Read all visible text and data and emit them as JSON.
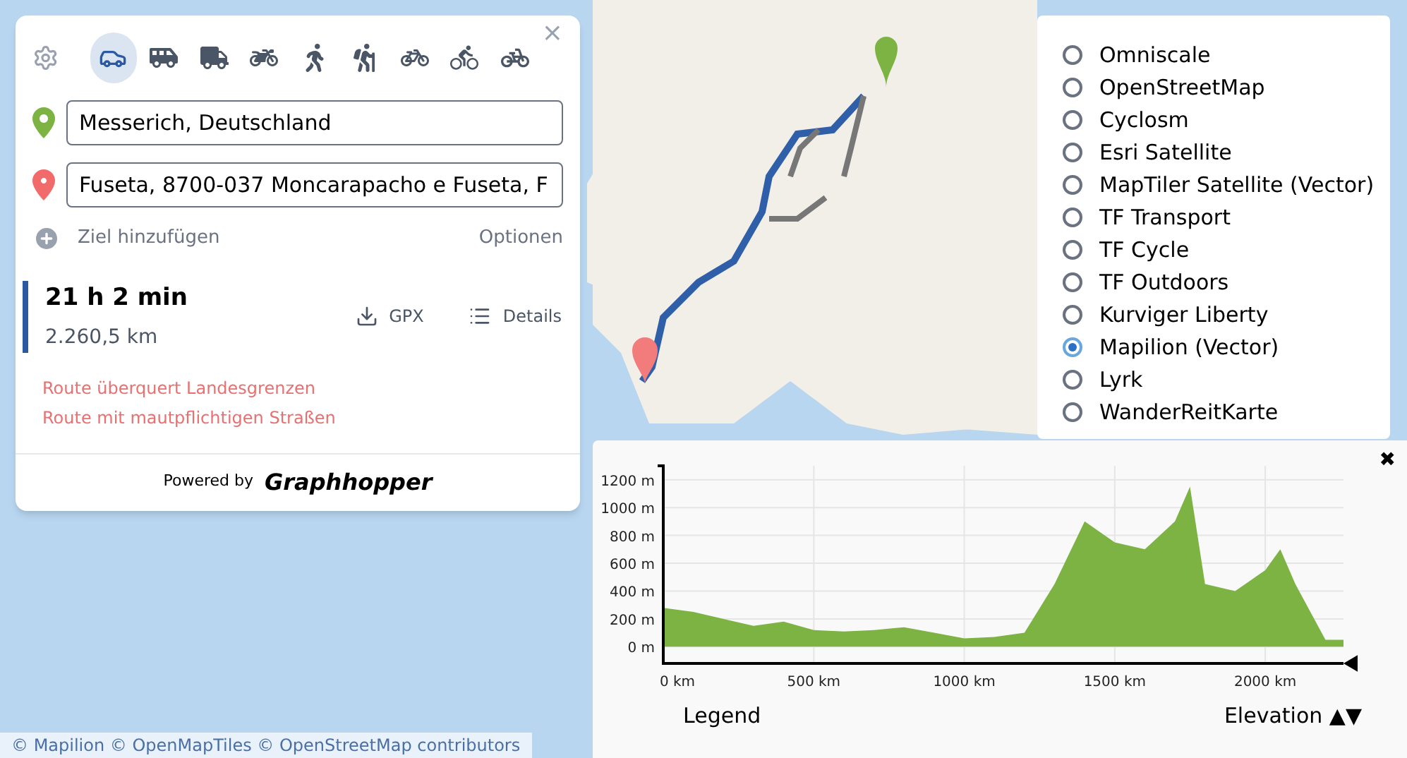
{
  "route_panel": {
    "profiles": [
      {
        "kind": "car",
        "selected": true
      },
      {
        "kind": "van",
        "selected": false
      },
      {
        "kind": "truck",
        "selected": false
      },
      {
        "kind": "scooter",
        "selected": false
      },
      {
        "kind": "walk",
        "selected": false
      },
      {
        "kind": "hike",
        "selected": false
      },
      {
        "kind": "bike",
        "selected": false
      },
      {
        "kind": "mtb",
        "selected": false
      },
      {
        "kind": "racebike",
        "selected": false
      }
    ],
    "close": "×",
    "points": [
      {
        "kind": "start",
        "value": "Messerich, Deutschland",
        "color": "#7cb342"
      },
      {
        "kind": "end",
        "value": "Fuseta, 8700-037 Moncarapacho e Fuseta, F",
        "color": "#f26b6b"
      }
    ],
    "add_destination": "Ziel hinzufügen",
    "options": "Optionen",
    "result": {
      "time": "21 h 2 min",
      "distance": "2.260,5 km",
      "gpx": "GPX",
      "details": "Details",
      "selected": true
    },
    "warnings": [
      "Route überquert Landesgrenzen",
      "Route mit mautpflichtigen Straßen"
    ],
    "powered_by": "Powered by",
    "brand": "Graphhopper"
  },
  "layers": [
    {
      "label": "Omniscale",
      "selected": false
    },
    {
      "label": "OpenStreetMap",
      "selected": false
    },
    {
      "label": "Cyclosm",
      "selected": false
    },
    {
      "label": "Esri Satellite",
      "selected": false
    },
    {
      "label": "MapTiler Satellite (Vector)",
      "selected": false
    },
    {
      "label": "TF Transport",
      "selected": false
    },
    {
      "label": "TF Cycle",
      "selected": false
    },
    {
      "label": "TF Outdoors",
      "selected": false
    },
    {
      "label": "Kurviger Liberty",
      "selected": false
    },
    {
      "label": "Mapilion (Vector)",
      "selected": true
    },
    {
      "label": "Lyrk",
      "selected": false
    },
    {
      "label": "WanderReitKarte",
      "selected": false
    }
  ],
  "elevation": {
    "close": "✖",
    "legend": "Legend",
    "arrows": "▲▼",
    "chart_data": {
      "type": "area",
      "x": [
        0,
        100,
        200,
        300,
        400,
        500,
        600,
        700,
        800,
        900,
        1000,
        1100,
        1200,
        1300,
        1400,
        1500,
        1600,
        1700,
        1750,
        1800,
        1900,
        2000,
        2050,
        2100,
        2200,
        2260
      ],
      "series": [
        {
          "name": "Elevation",
          "color": "#7cb342",
          "values": [
            280,
            250,
            200,
            150,
            180,
            120,
            110,
            120,
            140,
            100,
            60,
            70,
            100,
            450,
            900,
            750,
            700,
            900,
            1150,
            450,
            400,
            550,
            700,
            450,
            50,
            50
          ]
        }
      ],
      "xlim": [
        0,
        2260
      ],
      "ylim": [
        -120,
        1300
      ],
      "grid": true,
      "xticks": [
        {
          "value": 0,
          "label": "0 km"
        },
        {
          "value": 500,
          "label": "500 km"
        },
        {
          "value": 1000,
          "label": "1000 km"
        },
        {
          "value": 1500,
          "label": "1500 km"
        },
        {
          "value": 2000,
          "label": "2000 km"
        }
      ],
      "yticks": [
        {
          "value": 0,
          "label": "0 m"
        },
        {
          "value": 200,
          "label": "200 m"
        },
        {
          "value": 400,
          "label": "400 m"
        },
        {
          "value": 600,
          "label": "600 m"
        },
        {
          "value": 800,
          "label": "800 m"
        },
        {
          "value": 1000,
          "label": "1000 m"
        },
        {
          "value": 1200,
          "label": "1200 m"
        }
      ]
    }
  },
  "attribution": "© Mapilion  © OpenMapTiles  © OpenStreetMap contributors"
}
